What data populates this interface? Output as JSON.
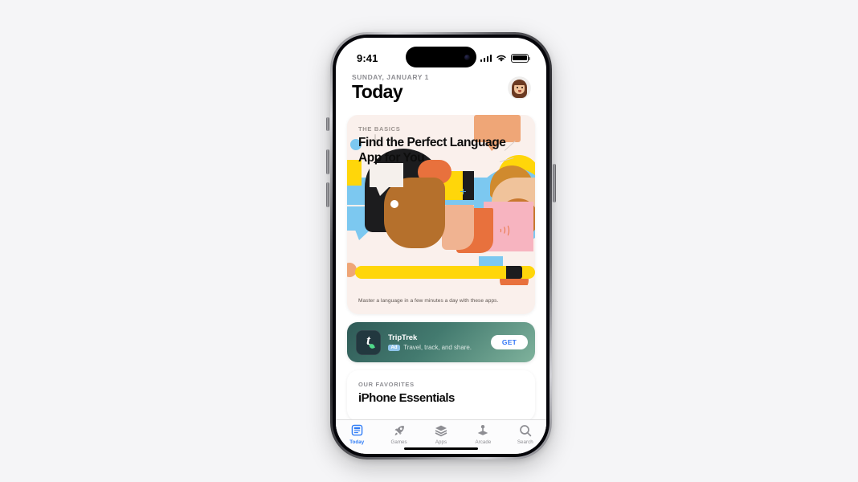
{
  "device": {
    "name": "iPhone 14 Pro",
    "status_bar": {
      "time": "9:41",
      "cellular_icon": "signal-bars-icon",
      "wifi_icon": "wifi-icon",
      "battery_icon": "battery-full-icon"
    }
  },
  "header": {
    "date": "SUNDAY, JANUARY 1",
    "title": "Today",
    "avatar_label": "account-avatar"
  },
  "featured_card": {
    "eyebrow": "THE BASICS",
    "title": "Find the Perfect Language App for You",
    "caption": "Master a language in a few minutes a day with these apps.",
    "background_color": "#faf0ec",
    "illustration_colors": {
      "orange": "#e8713d",
      "peach": "#efa677",
      "yellow": "#ffd60a",
      "blue": "#7cc8f0",
      "pink": "#f7b4c0",
      "dark": "#1c1c1e",
      "skin_brown": "#b5702c",
      "skin_light": "#f0c39b"
    }
  },
  "ad_row": {
    "app_name": "TripTrek",
    "badge": "Ad",
    "subtitle": "Travel, track, and share.",
    "get_label": "GET",
    "icon_letter": "t",
    "icon_background": "#22383f",
    "get_text_color": "#3478f6"
  },
  "favorites_card": {
    "eyebrow": "OUR FAVORITES",
    "title": "iPhone Essentials"
  },
  "tabbar": {
    "active_color": "#2f7cf6",
    "inactive_color": "#8e8e93",
    "tabs": [
      {
        "label": "Today",
        "icon": "today-card-icon",
        "active": true
      },
      {
        "label": "Games",
        "icon": "rocket-icon",
        "active": false
      },
      {
        "label": "Apps",
        "icon": "stacked-layers-icon",
        "active": false
      },
      {
        "label": "Arcade",
        "icon": "joystick-icon",
        "active": false
      },
      {
        "label": "Search",
        "icon": "search-icon",
        "active": false
      }
    ]
  },
  "page": {
    "background_color": "#f5f5f7"
  }
}
